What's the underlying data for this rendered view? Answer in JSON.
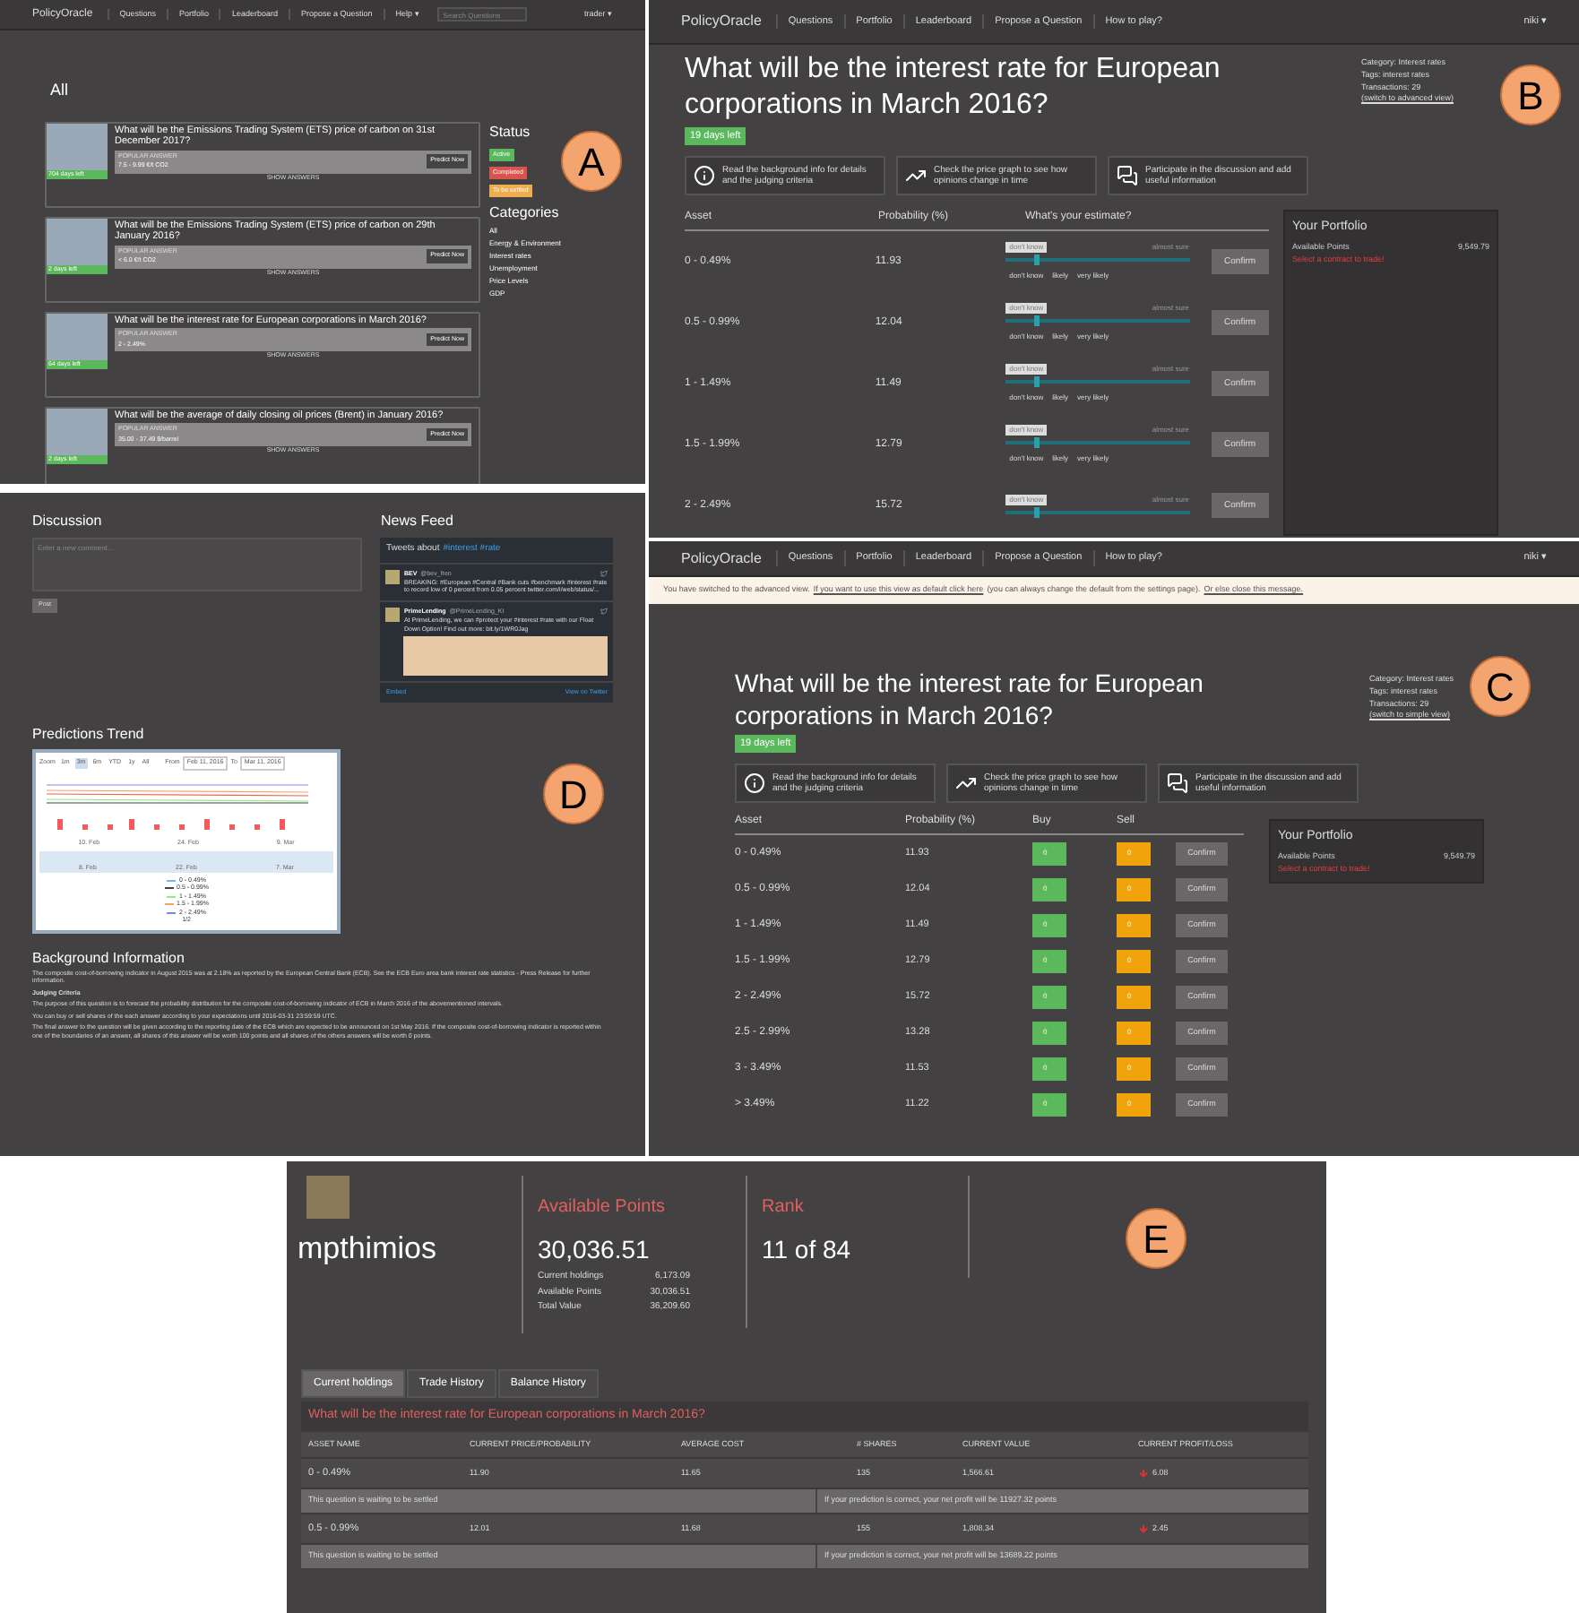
{
  "panel_a": {
    "badge": "A",
    "nav": {
      "brand": "PolicyOracle",
      "items": [
        "Questions",
        "Portfolio",
        "Leaderboard",
        "Propose a Question",
        "Help ▾"
      ],
      "search": {
        "placeholder": "Search Questions"
      },
      "user": "trader ▾"
    },
    "heading": "All",
    "questions": [
      {
        "title": "What will be the Emissions Trading System (ETS) price of carbon on 31st December 2017?",
        "days_left": "704 days left",
        "popular_label": "POPULAR ANSWER",
        "popular_answer": "7.5 - 9.99 €/t CO2",
        "predict": "Predict Now",
        "show": "SHOW ANSWERS"
      },
      {
        "title": "What will be the Emissions Trading System (ETS) price of carbon on 29th January 2016?",
        "days_left": "2 days left",
        "popular_label": "POPULAR ANSWER",
        "popular_answer": "< 6.0 €/t CO2",
        "predict": "Predict Now",
        "show": "SHOW ANSWERS"
      },
      {
        "title": "What will be the interest rate for European corporations in March 2016?",
        "days_left": "64 days left",
        "popular_label": "POPULAR ANSWER",
        "popular_answer": "2 - 2.49%",
        "predict": "Predict Now",
        "show": "SHOW ANSWERS"
      },
      {
        "title": "What will be the average of daily closing oil prices (Brent) in January 2016?",
        "days_left": "2 days left",
        "popular_label": "POPULAR ANSWER",
        "popular_answer": "35.00 - 37.49 $/barrel",
        "predict": "Predict Now",
        "show": "SHOW ANSWERS"
      }
    ],
    "status": {
      "title": "Status",
      "items": [
        {
          "label": "Active",
          "color": "#5cb85c"
        },
        {
          "label": "Completed",
          "color": "#d9534f"
        },
        {
          "label": "To be settled",
          "color": "#f0ad4e"
        }
      ]
    },
    "categories": {
      "title": "Categories",
      "items": [
        "All",
        "Energy & Environment",
        "Interest rates",
        "Unemployment",
        "Price Levels",
        "GDP"
      ]
    }
  },
  "panel_b": {
    "badge": "B",
    "nav": {
      "brand": "PolicyOracle",
      "items": [
        "Questions",
        "Portfolio",
        "Leaderboard",
        "Propose a Question",
        "How to play?"
      ],
      "user": "niki ▾"
    },
    "title": "What will be the interest rate for European corporations in March 2016?",
    "days_left": "19 days left",
    "meta": [
      "Category: Interest rates",
      "Tags: interest rates",
      "Transactions: 29"
    ],
    "switch_link": "(switch to advanced view)",
    "info_buttons": [
      {
        "kind": "info",
        "text": "Read the background info for details and the judging criteria"
      },
      {
        "kind": "chart",
        "text": "Check the price graph to see how opinions change in time"
      },
      {
        "kind": "chat",
        "text": "Participate in the discussion and add useful information"
      }
    ],
    "columns": [
      "Asset",
      "Probability (%)",
      "What's your estimate?"
    ],
    "rows": [
      {
        "asset": "0 - 0.49%",
        "probability": "11.93",
        "low": "don't know",
        "high": "almost sure",
        "level": 0.15,
        "scale": [
          "don't know",
          "likely",
          "very likely"
        ],
        "confirm": "Confirm"
      },
      {
        "asset": "0.5 - 0.99%",
        "probability": "12.04",
        "low": "don't know",
        "high": "almost sure",
        "level": 0.15,
        "scale": [
          "don't know",
          "likely",
          "very likely"
        ],
        "confirm": "Confirm"
      },
      {
        "asset": "1 - 1.49%",
        "probability": "11.49",
        "low": "don't know",
        "high": "almost sure",
        "level": 0.15,
        "scale": [
          "don't know",
          "likely",
          "very likely"
        ],
        "confirm": "Confirm"
      },
      {
        "asset": "1.5 - 1.99%",
        "probability": "12.79",
        "low": "don't know",
        "high": "almost sure",
        "level": 0.15,
        "scale": [
          "don't know",
          "likely",
          "very likely"
        ],
        "confirm": "Confirm"
      },
      {
        "asset": "2 - 2.49%",
        "probability": "15.72",
        "low": "don't know",
        "high": "almost sure",
        "level": 0.15,
        "confirm": "Confirm"
      }
    ],
    "portfolio": {
      "title": "Your Portfolio",
      "label": "Available Points",
      "value": "9,549.79",
      "hint": "Select a contract to trade!"
    }
  },
  "panel_c": {
    "badge": "C",
    "nav": {
      "brand": "PolicyOracle",
      "items": [
        "Questions",
        "Portfolio",
        "Leaderboard",
        "Propose a Question",
        "How to play?"
      ],
      "user": "niki ▾"
    },
    "notice": {
      "text": "You have switched to the advanced view.",
      "link": "If you want to use this view as default click here",
      "middle": "(you can always change the default from the settings page).",
      "close": "Or else close this message."
    },
    "title": "What will be the interest rate for European corporations in March 2016?",
    "days_left": "19 days left",
    "meta": [
      "Category: Interest rates",
      "Tags: interest rates",
      "Transactions: 29"
    ],
    "switch_link": "(switch to simple view)",
    "info_buttons": [
      {
        "kind": "info",
        "text": "Read the background info for details and the judging criteria"
      },
      {
        "kind": "chart",
        "text": "Check the price graph to see how opinions change in time"
      },
      {
        "kind": "chat",
        "text": "Participate in the discussion and add useful information"
      }
    ],
    "columns": [
      "Asset",
      "Probability (%)",
      "Buy",
      "Sell"
    ],
    "rows": [
      {
        "asset": "0 - 0.49%",
        "probability": "11.93",
        "buy": "0",
        "sell": "0",
        "confirm": "Confirm"
      },
      {
        "asset": "0.5 - 0.99%",
        "probability": "12.04",
        "buy": "0",
        "sell": "0",
        "confirm": "Confirm"
      },
      {
        "asset": "1 - 1.49%",
        "probability": "11.49",
        "buy": "0",
        "sell": "0",
        "confirm": "Confirm"
      },
      {
        "asset": "1.5 - 1.99%",
        "probability": "12.79",
        "buy": "0",
        "sell": "0",
        "confirm": "Confirm"
      },
      {
        "asset": "2 - 2.49%",
        "probability": "15.72",
        "buy": "0",
        "sell": "0",
        "confirm": "Confirm"
      },
      {
        "asset": "2.5 - 2.99%",
        "probability": "13.28",
        "buy": "0",
        "sell": "0",
        "confirm": "Confirm"
      },
      {
        "asset": "3 - 3.49%",
        "probability": "11.53",
        "buy": "0",
        "sell": "0",
        "confirm": "Confirm"
      },
      {
        "asset": "> 3.49%",
        "probability": "11.22",
        "buy": "0",
        "sell": "0",
        "confirm": "Confirm"
      }
    ],
    "portfolio": {
      "title": "Your Portfolio",
      "label": "Available Points",
      "value": "9,549.79",
      "hint": "Select a contract to trade!"
    }
  },
  "panel_d": {
    "badge": "D",
    "discussion": {
      "title": "Discussion",
      "placeholder": "Enter a new comment...",
      "post": "Post"
    },
    "news_feed": {
      "title": "News Feed",
      "header": "Tweets about",
      "tags": "#interest #rate",
      "tweets": [
        {
          "user": "BEV",
          "handle": "@bev_fren",
          "text": "BREAKING: #European #Central #Bank cuts #benchmark #interest #rate to record low of 0 percent from 0.05 percent twitter.com/i/web/status/..."
        },
        {
          "user": "PrimeLending",
          "handle": "@PrimeLending_KI",
          "text": "At PrimeLending, we can #protect your #interest #rate with our Float Down Option! Find out more: bit.ly/1WR0Jag"
        }
      ],
      "embed": "Embed",
      "view": "View on Twitter"
    },
    "trend": {
      "title": "Predictions Trend",
      "zoom_label": "Zoom",
      "ranges": [
        {
          "label": "1m",
          "selected": false
        },
        {
          "label": "3m",
          "selected": true
        },
        {
          "label": "6m",
          "selected": false
        },
        {
          "label": "YTD",
          "selected": false
        },
        {
          "label": "1y",
          "selected": false
        },
        {
          "label": "All",
          "selected": false
        }
      ],
      "from_label": "From",
      "from": "Feb 11, 2016",
      "to_label": "To",
      "to": "Mar 11, 2016",
      "x_labels": [
        "10. Feb",
        "24. Feb",
        "9. Mar"
      ],
      "nav_labels": [
        "8. Feb",
        "22. Feb",
        "7. Mar"
      ],
      "legend": [
        {
          "label": "0 - 0.49%",
          "color": "#7cb5ec"
        },
        {
          "label": "0.5 - 0.99%",
          "color": "#434348"
        },
        {
          "label": "1 - 1.49%",
          "color": "#90ed7d"
        },
        {
          "label": "1.5 - 1.99%",
          "color": "#f7a35c"
        },
        {
          "label": "2 - 2.49%",
          "color": "#8085e9"
        }
      ],
      "pager": "1/2"
    },
    "background": {
      "title": "Background Information",
      "paragraphs": [
        {
          "kind": "text",
          "text": "The composite cost-of-borrowing indicator in August 2015 was at 2.18% as reported by the European Central Bank (ECB). See the ECB Euro area bank interest rate statistics - Press Release for further information."
        },
        {
          "kind": "heading",
          "text": "Judging Criteria"
        },
        {
          "kind": "text",
          "text": "The purpose of this question is to forecast the probability distribution for the composite cost-of-borrowing indicator of ECB in March 2016 of the abovementioned intervals."
        },
        {
          "kind": "text",
          "text": "You can buy or sell shares of the each answer according to your expectations until 2016-03-31 23:59:59 UTC."
        },
        {
          "kind": "text",
          "text": "The final answer to the question will be given according to the reporting date of the ECB which are expected to be announced on 1st May 2016. If the composite cost-of-borrowing indicator is reported within one of the boundaries of an answer, all shares of this answer will be worth 100 points and all shares of the others answers will be worth 0 points."
        }
      ]
    }
  },
  "panel_e": {
    "badge": "E",
    "user": "mpthimios",
    "points": {
      "title": "Available Points",
      "value": "30,036.51",
      "breakdown": [
        {
          "label": "Current holdings",
          "value": "6,173.09"
        },
        {
          "label": "Available Points",
          "value": "30,036.51"
        },
        {
          "label": "Total Value",
          "value": "36,209.60"
        }
      ]
    },
    "rank": {
      "title": "Rank",
      "value": "11 of 84"
    },
    "tabs": [
      {
        "label": "Current holdings",
        "selected": true
      },
      {
        "label": "Trade History",
        "selected": false
      },
      {
        "label": "Balance History",
        "selected": false
      }
    ],
    "table": {
      "question": "What will be the interest rate for European corporations in March 2016?",
      "columns": [
        "ASSET NAME",
        "CURRENT PRICE/PROBABILITY",
        "AVERAGE COST",
        "# SHARES",
        "CURRENT VALUE",
        "CURRENT PROFIT/LOSS"
      ],
      "rows": [
        {
          "asset": "0 - 0.49%",
          "price": "11.90",
          "avg_cost": "11.65",
          "shares": "135",
          "value": "1,566.61",
          "profit": "6.08",
          "status": "This question is waiting to be settled",
          "net": "If your prediction is correct, your net profit will be 11927.32 points"
        },
        {
          "asset": "0.5 - 0.99%",
          "price": "12.01",
          "avg_cost": "11.68",
          "shares": "155",
          "value": "1,808.34",
          "profit": "2.45",
          "status": "This question is waiting to be settled",
          "net": "If your prediction is correct, your net profit will be 13689.22 points"
        }
      ]
    }
  }
}
